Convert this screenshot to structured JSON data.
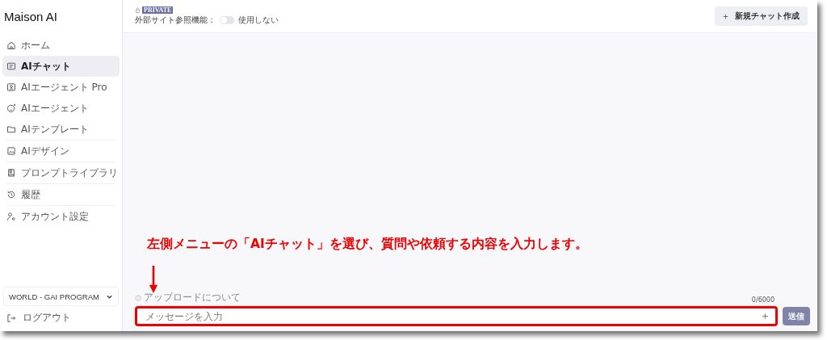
{
  "sidebar": {
    "logo": "Maison AI",
    "items": [
      {
        "label": "ホーム",
        "selected": false
      },
      {
        "label": "AIチャット",
        "selected": true
      },
      {
        "label": "AIエージェント Pro",
        "selected": false
      },
      {
        "label": "AIエージェント",
        "selected": false
      },
      {
        "label": "AIテンプレート",
        "selected": false
      },
      {
        "label": "AIデザイン",
        "selected": false
      },
      {
        "label": "プロンプトライブラリ",
        "selected": false
      },
      {
        "label": "履歴",
        "selected": false
      },
      {
        "label": "アカウント設定",
        "selected": false
      }
    ],
    "workspace": "WORLD - GAI PROGRAM",
    "logout": "ログアウト"
  },
  "header": {
    "badge": "PRIVATE",
    "setting_label": "外部サイト参照機能：",
    "toggle": {
      "on": false,
      "label": "使用しない"
    },
    "new_chat": "新規チャット作成"
  },
  "annotation": "左側メニューの「AIチャット」を選び、質問や依頼する内容を入力します。",
  "composer": {
    "upload_note": "アップロードについて",
    "counter": "0/6000",
    "placeholder": "メッセージを入力",
    "add": "+",
    "send": "送信"
  }
}
